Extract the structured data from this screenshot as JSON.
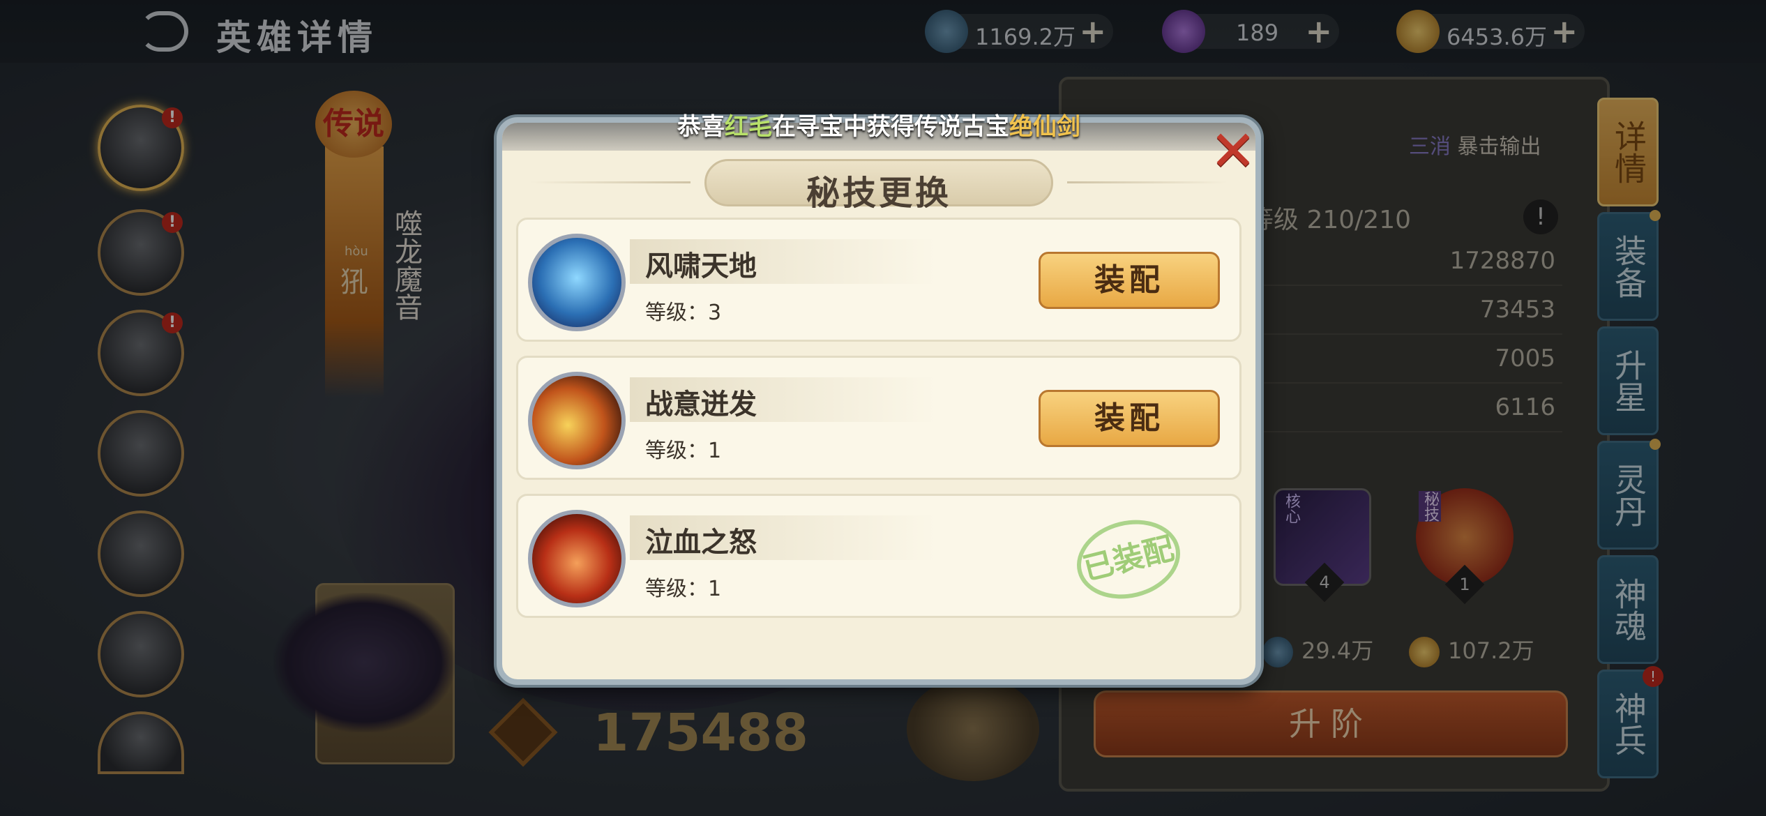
{
  "header": {
    "title": "英雄详情",
    "resources": [
      {
        "icon": "globe-coin-icon",
        "value": "1169.2万"
      },
      {
        "icon": "purple-orb-icon",
        "value": "189"
      },
      {
        "icon": "gold-coin-icon",
        "value": "6453.6万"
      }
    ],
    "plus": "+"
  },
  "sidebar": {
    "badge": "!"
  },
  "hero": {
    "rarity": "传说",
    "name_pinyin": "hòu",
    "name_char": "犼",
    "title": "噬龙魔音",
    "power": "175488"
  },
  "details": {
    "tag_a": "三消",
    "tag_b": "暴击输出",
    "level": "等级 210/210",
    "help": "!",
    "stats": [
      "1728870",
      "73453",
      "7005",
      "6116"
    ],
    "skill_tiles": [
      {
        "label": "核心",
        "num": "4"
      },
      {
        "label": "秘技",
        "num": "1"
      }
    ],
    "costs": [
      "29.4万",
      "107.2万"
    ],
    "upgrade_label": "升阶"
  },
  "tabs": [
    {
      "label": "详情",
      "active": true
    },
    {
      "label": "装备"
    },
    {
      "label": "升星"
    },
    {
      "label": "灵丹"
    },
    {
      "label": "神魂"
    },
    {
      "label": "神兵"
    }
  ],
  "banner": {
    "prefix": "恭喜",
    "player": "红毛",
    "middle": "在寻宝中获得传说古宝",
    "item": "绝仙剑"
  },
  "popup": {
    "title": "秘技更换",
    "close": "✕",
    "skills": [
      {
        "name": "风啸天地",
        "level": "等级：3",
        "action": "装配"
      },
      {
        "name": "战意迸发",
        "level": "等级：1",
        "action": "装配"
      },
      {
        "name": "泣血之怒",
        "level": "等级：1",
        "status": "已装配"
      }
    ]
  }
}
